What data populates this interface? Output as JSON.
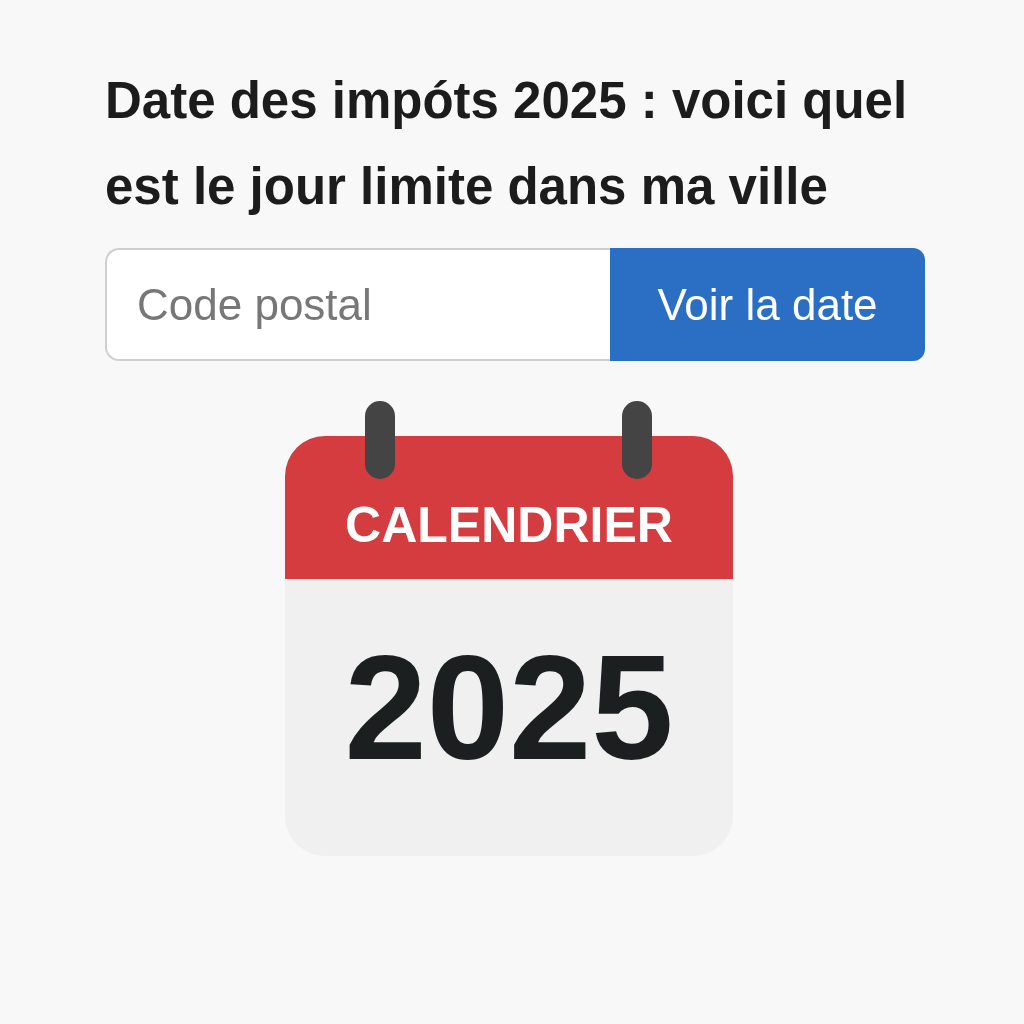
{
  "heading": "Date des impóts 2025 : voici quel est le jour limite dans ma ville",
  "search": {
    "placeholder": "Code postal",
    "button": "Voir la date"
  },
  "calendar": {
    "header": "CALENDRIER",
    "year": "2025"
  }
}
